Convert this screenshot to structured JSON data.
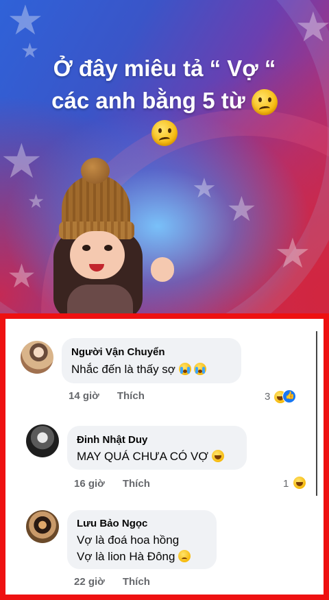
{
  "banner": {
    "headline_line1": "Ở đây miêu tả “ Vợ “",
    "headline_line2": "các anh bằng 5 từ",
    "headline_emoji": "confused-face-emoji",
    "colors": {
      "blue": "#2f62d8",
      "purple": "#6b3fb0",
      "red": "#d12a45"
    }
  },
  "comments": [
    {
      "name": "Người Vận Chuyển",
      "text": "Nhắc đến là thấy sợ",
      "text_emojis": [
        "loudly-crying-face",
        "loudly-crying-face"
      ],
      "time": "14 giờ",
      "like_label": "Thích",
      "reaction_count": "3",
      "reactions": [
        "laugh",
        "like"
      ]
    },
    {
      "name": "Đinh Nhật Duy",
      "text": "MAY QUÁ CHƯA CÓ VỢ",
      "text_emojis": [
        "tears-of-joy"
      ],
      "time": "16 giờ",
      "like_label": "Thích",
      "reaction_count": "1",
      "reactions": [
        "laugh"
      ]
    },
    {
      "name": "Lưu Bảo Ngọc",
      "text_line1": "Vợ là đoá hoa hồng",
      "text_line2": "Vợ là lion Hà Đông",
      "text_emojis": [
        "downcast-face-with-sweat"
      ],
      "time": "22 giờ",
      "like_label": "Thích"
    }
  ],
  "panel": {
    "border_color": "#ee1111",
    "bubble_color": "#f0f2f5"
  }
}
